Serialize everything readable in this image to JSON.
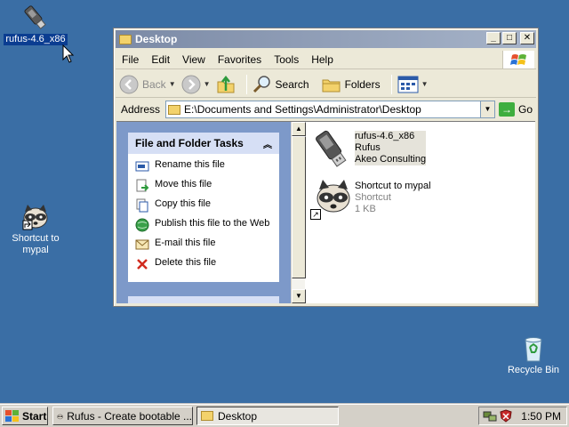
{
  "desktop": {
    "icons": [
      {
        "label": "rufus-4.6_x86"
      },
      {
        "label": "Shortcut to mypal"
      },
      {
        "label": "Recycle Bin"
      }
    ]
  },
  "window": {
    "title": "Desktop",
    "controls": {
      "minimize": "_",
      "maximize": "□",
      "close": "✕"
    },
    "menu": [
      "File",
      "Edit",
      "View",
      "Favorites",
      "Tools",
      "Help"
    ],
    "toolbar": {
      "back": "Back",
      "search": "Search",
      "folders": "Folders"
    },
    "address": {
      "label": "Address",
      "value": "E:\\Documents and Settings\\Administrator\\Desktop",
      "go": "Go"
    },
    "tasks_panel": {
      "title": "File and Folder Tasks",
      "items": [
        {
          "label": "Rename this file",
          "icon": "rename-icon"
        },
        {
          "label": "Move this file",
          "icon": "move-icon"
        },
        {
          "label": "Copy this file",
          "icon": "copy-icon"
        },
        {
          "label": "Publish this file to the Web",
          "icon": "publish-web-icon"
        },
        {
          "label": "E-mail this file",
          "icon": "email-icon"
        },
        {
          "label": "Delete this file",
          "icon": "delete-icon"
        }
      ]
    },
    "files": [
      {
        "name": "rufus-4.6_x86",
        "line2": "Rufus",
        "line3": "Akeo Consulting",
        "selected": true
      },
      {
        "name": "Shortcut to mypal",
        "line2": "Shortcut",
        "line3": "1 KB",
        "selected": false
      }
    ]
  },
  "taskbar": {
    "start": "Start",
    "tasks": [
      {
        "label": "Rufus - Create bootable ...",
        "active": false
      },
      {
        "label": "Desktop",
        "active": true
      }
    ],
    "clock": "1:50 PM"
  },
  "colors": {
    "desktop_bg": "#3a6ea5",
    "titlebar_inactive": "#7b8aa6",
    "task_pane_bg": "#7d99c9",
    "panel_header": "#d6dff5"
  }
}
